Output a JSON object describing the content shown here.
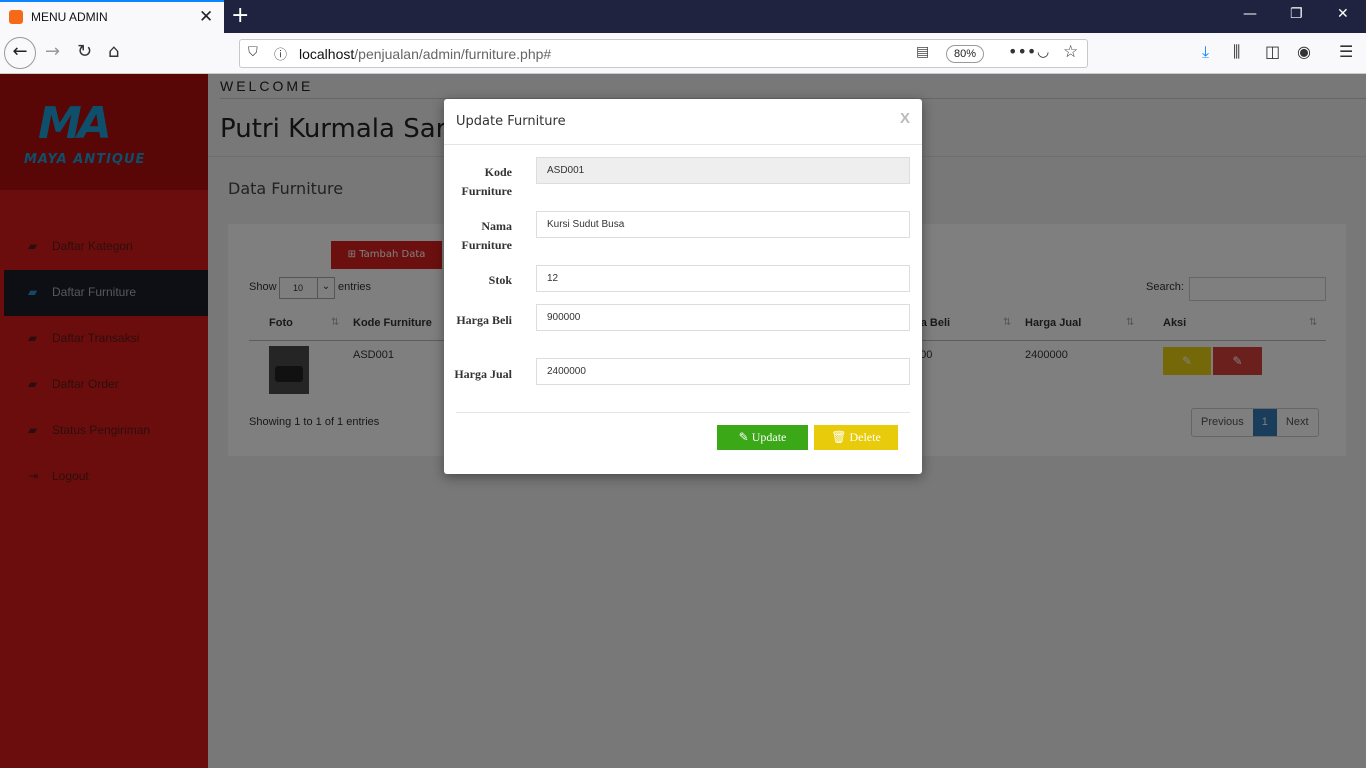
{
  "browser": {
    "tab_title": "MENU ADMIN",
    "url_host": "localhost",
    "url_path": "/penjualan/admin/furniture.php#",
    "zoom": "80%"
  },
  "sidebar": {
    "logo_mark": "MA",
    "logo_text": "MAYA ANTIQUE",
    "items": [
      {
        "label": "Daftar Kategori",
        "icon": "book-icon"
      },
      {
        "label": "Daftar Furniture",
        "icon": "book-icon",
        "active": true
      },
      {
        "label": "Daftar Transaksi",
        "icon": "book-icon"
      },
      {
        "label": "Daftar Order",
        "icon": "book-icon"
      },
      {
        "label": "Status Pengiriman",
        "icon": "book-icon"
      },
      {
        "label": "Logout",
        "icon": "logout-icon"
      }
    ]
  },
  "header": {
    "welcome": "WELCOME",
    "user_name": "Putri Kurmala Sari"
  },
  "main": {
    "section_title": "Data Furniture",
    "add_button": "Tambah Data",
    "show_label": "Show",
    "show_value": "10",
    "entries_label": "entries",
    "search_label": "Search:",
    "columns": [
      "Foto",
      "Kode Furniture",
      "ga Beli",
      "Harga Jual",
      "Aksi"
    ],
    "row": {
      "kode": "ASD001",
      "beli": "000",
      "jual": "2400000"
    },
    "info": "Showing 1 to 1 of 1 entries",
    "pager": {
      "previous": "Previous",
      "current": "1",
      "next": "Next"
    }
  },
  "modal": {
    "title": "Update Furniture",
    "close": "X",
    "fields": [
      {
        "label": "Kode Furniture",
        "value": "ASD001"
      },
      {
        "label": "Nama Furniture",
        "value": "Kursi Sudut Busa"
      },
      {
        "label": "Stok",
        "value": "12"
      },
      {
        "label": "Harga Beli",
        "value": "900000"
      },
      {
        "label": "Harga Jual",
        "value": "2400000"
      }
    ],
    "update_button": "Update",
    "delete_button": "Delete"
  }
}
